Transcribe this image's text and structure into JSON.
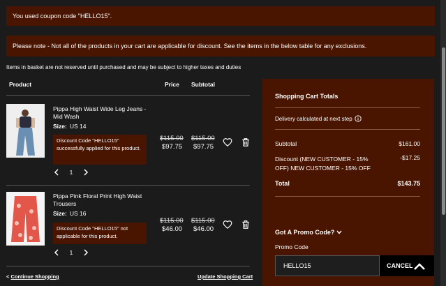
{
  "notices": {
    "coupon_used": "You used coupon code \"HELLO15\".",
    "please_note": "Please note - Not all of the products in your cart are applicable for discount. See the items in the below table for any exclusions."
  },
  "basket_note": "Items in basket are not reserved until purchased and may be subject to higher taxes and duties",
  "columns": {
    "product": "Product",
    "price": "Price",
    "subtotal": "Subtotal"
  },
  "items": [
    {
      "name": "Pippa High Waist Wide Leg Jeans - Mid Wash",
      "size_label": "Size:",
      "size_value": "US 14",
      "discount_msg": "Discount Code \"HELLO15\" successfully applied for this product.",
      "qty": "1",
      "price_old": "$115.00",
      "price_new": "$97.75",
      "subtotal_old": "$115.00",
      "subtotal_new": "$97.75"
    },
    {
      "name": "Pippa Pink Floral Print High Waist Trousers",
      "size_label": "Size:",
      "size_value": "US 16",
      "discount_msg": "Discount Code \"HELLO15\" not applicable for this product.",
      "qty": "1",
      "price_old": "$115.00",
      "price_new": "$46.00",
      "subtotal_old": "$115.00",
      "subtotal_new": "$46.00"
    }
  ],
  "footer": {
    "continue": "Continue Shopping",
    "continue_prefix": "<",
    "update": "Update Shopping Cart"
  },
  "totals": {
    "title": "Shopping Cart Totals",
    "delivery": "Delivery calculated at next step",
    "subtotal_label": "Subtotal",
    "subtotal_value": "$161.00",
    "discount_label_1": "Discount (NEW CUSTOMER - 15%",
    "discount_label_2": "OFF) NEW CUSTOMER - 15% OFF",
    "discount_value": "-$17.25",
    "total_label": "Total",
    "total_value": "$143.75",
    "promo_toggle": "Got A Promo Code?",
    "promo_label": "Promo Code",
    "promo_value": "HELLO15",
    "promo_button": "CANCEL"
  },
  "colors": {
    "background": "#1b1b1b",
    "accent_panel": "#4a1500",
    "text": "#ffffff"
  }
}
